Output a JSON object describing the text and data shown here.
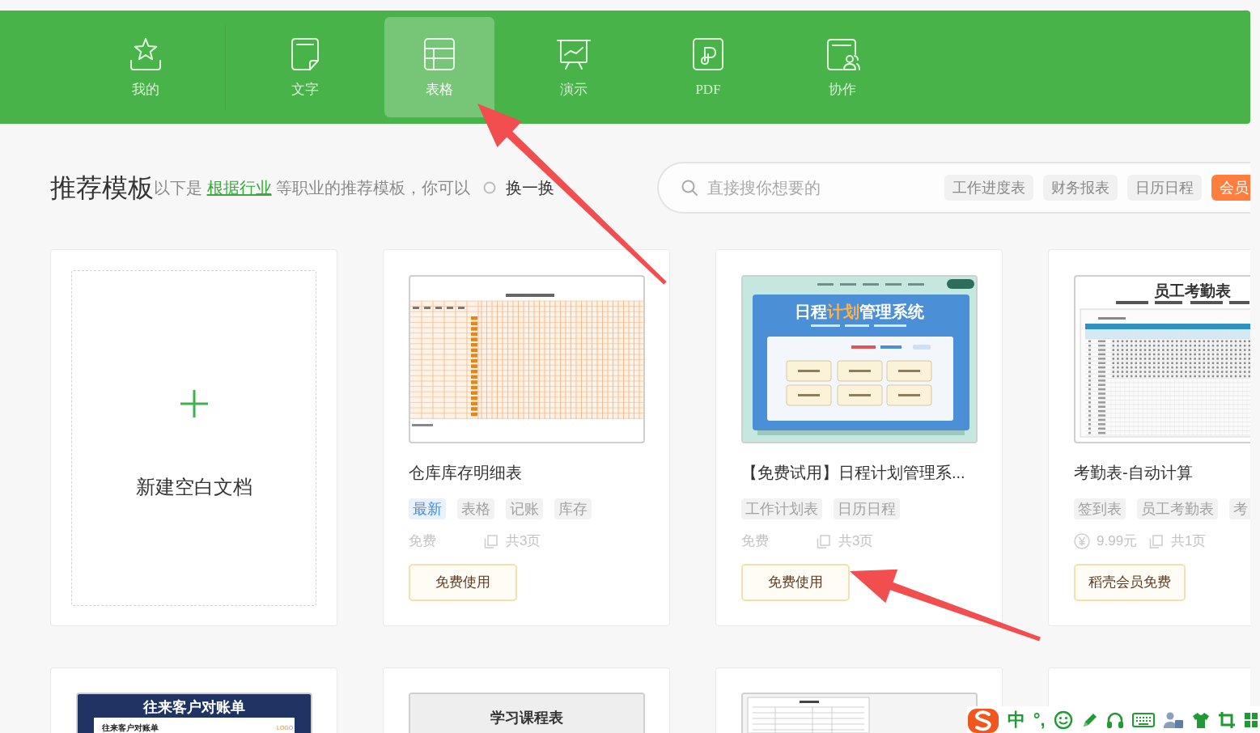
{
  "nav": [
    {
      "label": "我的",
      "kind": "favorites",
      "selected": false
    },
    {
      "label": "文字",
      "kind": "writer",
      "selected": false
    },
    {
      "label": "表格",
      "kind": "spreadsheet",
      "selected": true
    },
    {
      "label": "演示",
      "kind": "presentation",
      "selected": false
    },
    {
      "label": "PDF",
      "kind": "pdf",
      "selected": false
    },
    {
      "label": "协作",
      "kind": "collaboration",
      "selected": false
    }
  ],
  "section": {
    "title": "推荐模板",
    "subtitle_before": "以下是",
    "subtitle_link": "根据行业",
    "subtitle_after": "等职业的推荐模板，你可以",
    "refresh": "换一换"
  },
  "search": {
    "placeholder": "直接搜你想要的",
    "tags": [
      {
        "label": "工作进度表",
        "kind": "plain"
      },
      {
        "label": "财务报表",
        "kind": "plain"
      },
      {
        "label": "日历日程",
        "kind": "plain"
      },
      {
        "label": "会员",
        "kind": "vip"
      }
    ]
  },
  "templates": [
    {
      "kind": "blank",
      "label": "新建空白文档"
    },
    {
      "kind": "template",
      "thumbnail": {
        "kind": "inventory"
      },
      "title": "仓库库存明细表",
      "tags": [
        {
          "label": "最新",
          "kind": "new"
        },
        {
          "label": "表格",
          "kind": "plain"
        },
        {
          "label": "记账",
          "kind": "plain"
        },
        {
          "label": "库存",
          "kind": "plain"
        }
      ],
      "price": {
        "label": "免费",
        "kind": "free"
      },
      "pages": "共3页",
      "button": "免费使用"
    },
    {
      "kind": "template",
      "thumbnail": {
        "kind": "schedule",
        "title_parts": [
          "日程",
          "计划",
          "管理系统"
        ]
      },
      "title": "【免费试用】日程计划管理系...",
      "tags": [
        {
          "label": "工作计划表",
          "kind": "plain"
        },
        {
          "label": "日历日程",
          "kind": "plain"
        }
      ],
      "price": {
        "label": "免费",
        "kind": "free"
      },
      "pages": "共3页",
      "button": "免费使用"
    },
    {
      "kind": "template",
      "thumbnail": {
        "kind": "attendance",
        "title": "员工考勤表"
      },
      "title": "考勤表-自动计算",
      "tags": [
        {
          "label": "签到表",
          "kind": "plain"
        },
        {
          "label": "员工考勤表",
          "kind": "plain"
        },
        {
          "label": "考",
          "kind": "plain"
        }
      ],
      "price": {
        "label": "9.99元",
        "kind": "paid"
      },
      "pages": "共1页",
      "button": "稻壳会员免费"
    },
    {
      "kind": "template",
      "thumbnail": {
        "kind": "statement",
        "title": "往来客户对账单",
        "subtitle": "往来客户对账单",
        "logo": "LOGO"
      }
    },
    {
      "kind": "template",
      "thumbnail": {
        "kind": "course",
        "title": "学习课程表"
      }
    },
    {
      "kind": "template",
      "thumbnail": {
        "kind": "contract"
      }
    },
    {
      "kind": "empty"
    }
  ],
  "annotations": [
    {
      "kind": "arrow"
    },
    {
      "kind": "arrow"
    }
  ],
  "input_method_bar": {
    "items": [
      {
        "kind": "logo"
      },
      {
        "kind": "text",
        "label": "中"
      },
      {
        "kind": "text",
        "label": "°,"
      },
      {
        "kind": "smiley"
      },
      {
        "kind": "pen"
      },
      {
        "kind": "headphones"
      },
      {
        "kind": "keyboard"
      },
      {
        "kind": "person"
      },
      {
        "kind": "shirt"
      },
      {
        "kind": "crop"
      },
      {
        "kind": "grid"
      }
    ]
  }
}
